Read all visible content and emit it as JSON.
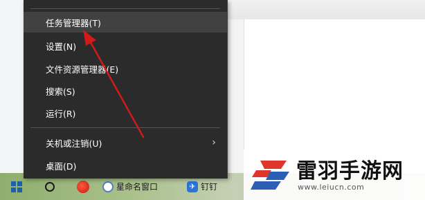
{
  "context_menu": {
    "items": [
      {
        "label": "任务管理器(T)",
        "highlighted": true
      },
      {
        "label": "设置(N)"
      },
      {
        "label": "文件资源管理器(E)"
      },
      {
        "label": "搜索(S)"
      },
      {
        "label": "运行(R)"
      },
      {
        "label": "关机或注销(U)",
        "has_submenu": true
      },
      {
        "label": "桌面(D)"
      }
    ]
  },
  "taskbar": {
    "app2_label": "星命名窗口",
    "app3_label": "钉钉",
    "start_icon": "windows-logo-icon",
    "search_icon": "search-icon"
  },
  "watermark": {
    "title": "雷羽手游网",
    "url": "www.leiucn.com"
  },
  "colors": {
    "menu_bg": "#2b2b2b",
    "menu_highlight": "#414141",
    "arrow": "#d11a1a",
    "watermark_red": "#e0352b",
    "watermark_blue": "#2c5fb4"
  }
}
